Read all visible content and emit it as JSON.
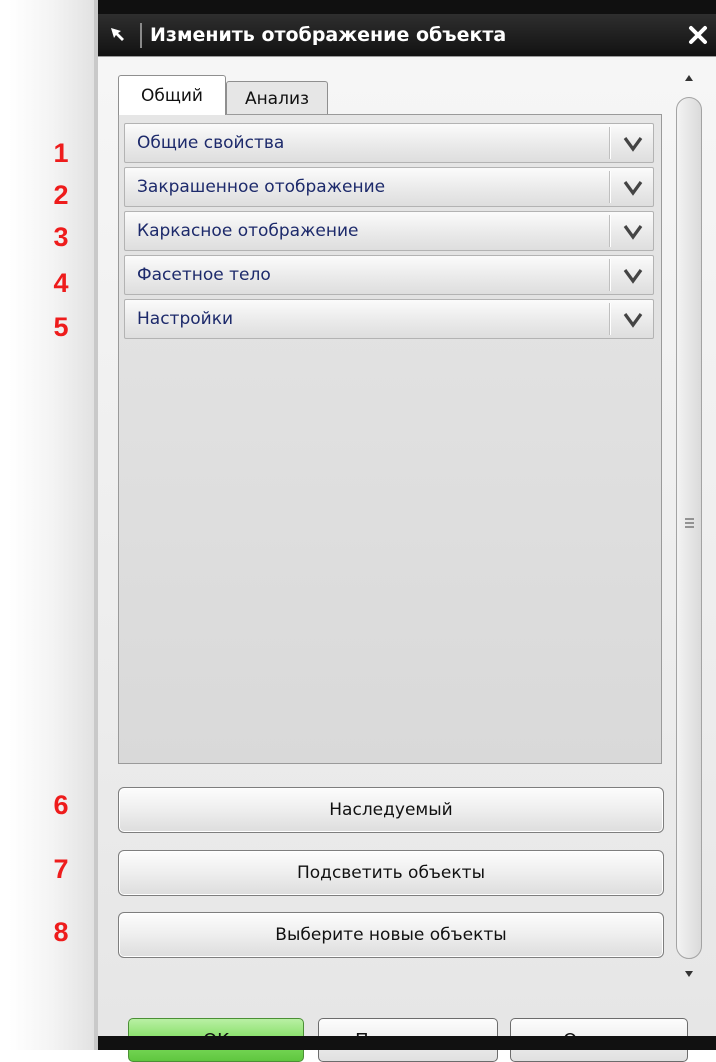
{
  "window": {
    "title": "Изменить отображение объекта",
    "pin_icon": "pin-arrow-icon",
    "close_icon": "close-icon"
  },
  "tabs": [
    {
      "label": "Общий",
      "active": true
    },
    {
      "label": "Анализ",
      "active": false
    }
  ],
  "groups": [
    {
      "label": "Общие свойства",
      "icon": "chevron-down-icon"
    },
    {
      "label": "Закрашенное отображение",
      "icon": "chevron-down-icon"
    },
    {
      "label": "Каркасное отображение",
      "icon": "chevron-down-icon"
    },
    {
      "label": "Фасетное тело",
      "icon": "chevron-down-icon"
    },
    {
      "label": "Настройки",
      "icon": "chevron-down-icon"
    }
  ],
  "actions": [
    {
      "label": "Наследуемый"
    },
    {
      "label": "Подсветить объекты"
    },
    {
      "label": "Выберите новые объекты"
    }
  ],
  "footer": {
    "ok_label": "OK",
    "apply_label": "Применить",
    "cancel_label": "Отмена"
  },
  "callouts": [
    "1",
    "2",
    "3",
    "4",
    "5",
    "6",
    "7",
    "8"
  ],
  "colors": {
    "callout": "#ee1c1c",
    "group_text": "#1d2a6b",
    "ok_button": "#7edc5e",
    "titlebar": "#1a1a1a"
  }
}
